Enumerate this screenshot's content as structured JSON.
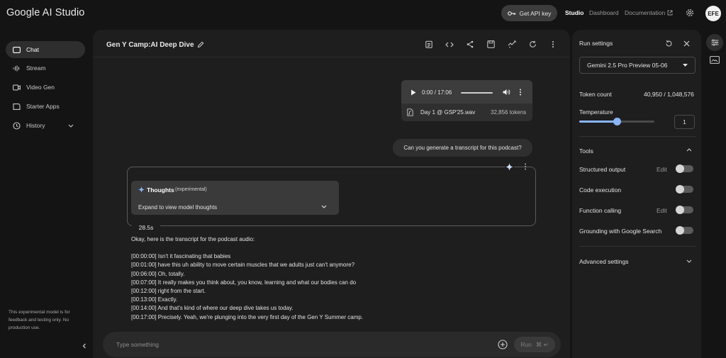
{
  "app": {
    "name": "Google AI Studio"
  },
  "topbar": {
    "api_key_label": "Get API key",
    "nav": {
      "studio": "Studio",
      "dashboard": "Dashboard",
      "documentation": "Documentation"
    },
    "avatar_initials": "EFE"
  },
  "sidebar": {
    "items": [
      {
        "label": "Chat",
        "icon": "chat-icon"
      },
      {
        "label": "Stream",
        "icon": "waveform-icon"
      },
      {
        "label": "Video Gen",
        "icon": "video-icon"
      },
      {
        "label": "Starter Apps",
        "icon": "apps-icon"
      },
      {
        "label": "History",
        "icon": "history-icon"
      }
    ],
    "note": "This experimental model is for feedback and testing only. No production use."
  },
  "chat": {
    "title": "Gen Y Camp:AI Deep Dive",
    "audio": {
      "time": "0:00 / 17:06",
      "file_name": "Day 1 @ GSP'25.wav",
      "tokens": "32,856 tokens"
    },
    "user_message": "Can you generate a transcript for this podcast?",
    "thoughts": {
      "title": "Thoughts",
      "tag": "(experimental)",
      "expand_label": "Expand to view model thoughts"
    },
    "elapsed": "28.5s",
    "response": {
      "intro": "Okay, here is the transcript for the podcast audio:",
      "lines": [
        "[00:00:00] Isn't it fascinating that babies",
        "[00:01:00] have this uh ability to move certain muscles that we adults just can't anymore?",
        "[00:06:00] Oh, totally.",
        "[00:07:00] It really makes you think about, you know, learning and what our bodies can do",
        "[00:12:00] right from the start.",
        "[00:13:00] Exactly.",
        "[00:14:00] And that's kind of where our deep dive takes us today.",
        "[00:17:00] Precisely. Yeah, we're plunging into the very first day of the Gen Y Summer camp."
      ]
    },
    "input": {
      "placeholder": "Type something",
      "run_label": "Run",
      "run_shortcut": "⌘ ↵"
    }
  },
  "settings": {
    "title": "Run settings",
    "model": "Gemini 2.5 Pro Preview 05-06",
    "token_count_label": "Token count",
    "token_count_value": "40,950 / 1,048,576",
    "temperature_label": "Temperature",
    "temperature_value": "1",
    "temperature_level": 0.5,
    "tools_label": "Tools",
    "tools": [
      {
        "label": "Structured output",
        "edit": "Edit"
      },
      {
        "label": "Code execution",
        "edit": ""
      },
      {
        "label": "Function calling",
        "edit": "Edit"
      },
      {
        "label": "Grounding with Google Search",
        "edit": ""
      }
    ],
    "advanced_label": "Advanced settings"
  },
  "colors": {
    "accent": "#8ab4f8",
    "background": "#141414",
    "panel": "#1e1e1e"
  }
}
